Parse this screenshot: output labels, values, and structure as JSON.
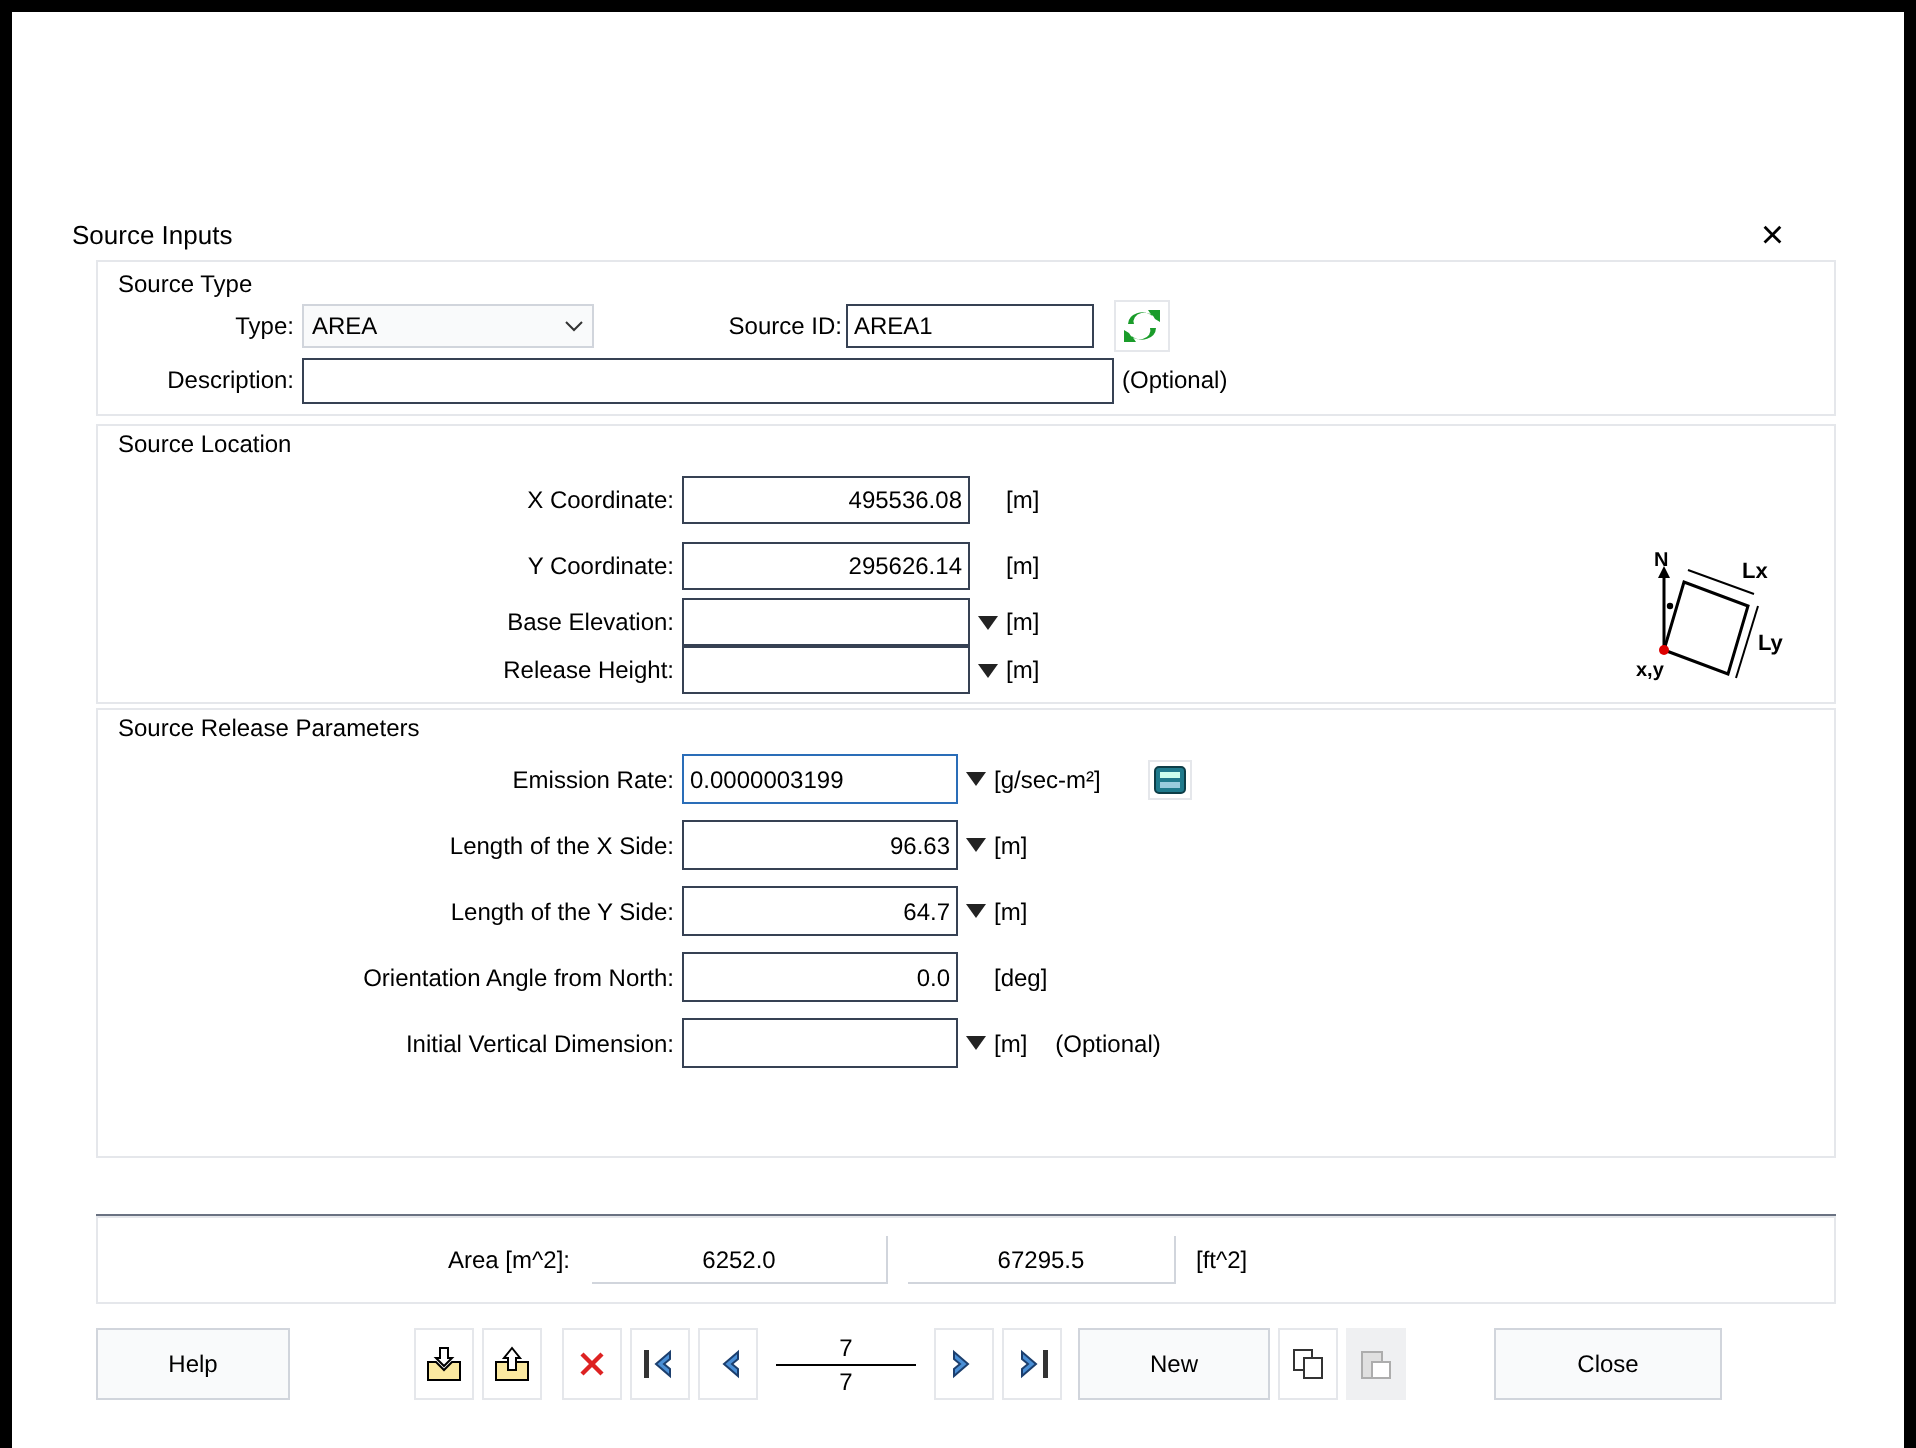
{
  "window": {
    "title": "Source Inputs",
    "close": "×"
  },
  "source_type": {
    "title": "Source Type",
    "type_label": "Type:",
    "type_value": "AREA",
    "source_id_label": "Source ID:",
    "source_id_value": "AREA1",
    "description_label": "Description:",
    "description_note": "(Optional)"
  },
  "source_location": {
    "title": "Source Location",
    "fields": [
      {
        "label": "X Coordinate:",
        "value": "495536.08",
        "unit": "[m]",
        "dropdown": false
      },
      {
        "label": "Y Coordinate:",
        "value": "295626.14",
        "unit": "[m]",
        "dropdown": false
      },
      {
        "label": "Base Elevation:",
        "unit": "[m]",
        "dropdown": true
      },
      {
        "label": "Release Height:",
        "unit": "[m]",
        "dropdown": true
      }
    ],
    "diagram_labels": {
      "north": "N",
      "lx": "Lx",
      "ly": "Ly",
      "origin": "x,y"
    }
  },
  "release_parameters": {
    "title": "Source Release Parameters",
    "fields": [
      {
        "label": "Emission Rate:",
        "value": "0.0000003199",
        "unit": "[g/sec-m²]",
        "dropdown": true,
        "focused": true,
        "kind": "text",
        "calculator": true
      },
      {
        "label": "Length of the X Side:",
        "value": "96.63",
        "unit": "[m]",
        "dropdown": true,
        "focused": false,
        "kind": "number",
        "calculator": false
      },
      {
        "label": "Length of the Y Side:",
        "value": "64.7",
        "unit": "[m]",
        "dropdown": true,
        "focused": false,
        "kind": "number",
        "calculator": false
      },
      {
        "label": "Orientation Angle from North:",
        "value": "0.0",
        "unit": "[deg]",
        "dropdown": false,
        "focused": false,
        "kind": "number",
        "calculator": false
      },
      {
        "label": "Initial Vertical Dimension:",
        "unit": "[m]",
        "note": "(Optional)",
        "dropdown": true,
        "focused": false,
        "kind": "number",
        "calculator": false
      }
    ]
  },
  "area": {
    "label": "Area [m^2]:",
    "value_m2": "6252.0",
    "value_ft2": "67295.5",
    "unit_ft2": "[ft^2]"
  },
  "toolbar": {
    "help": "Help",
    "record_current": "7",
    "record_total": "7",
    "new": "New",
    "close": "Close",
    "paste_disabled": true
  }
}
